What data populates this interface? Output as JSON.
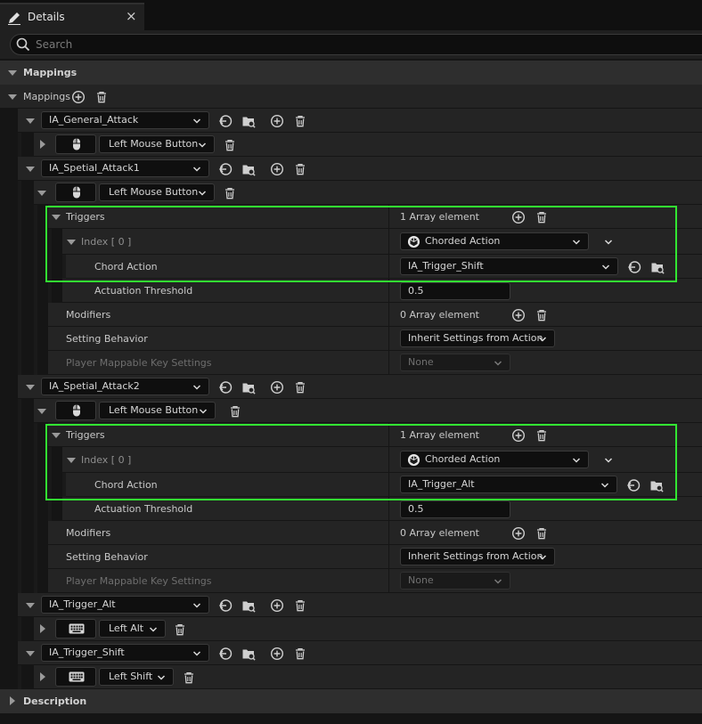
{
  "tab": {
    "title": "Details",
    "close": "×"
  },
  "search": {
    "placeholder": "Search"
  },
  "sections": {
    "mappings_category": "Mappings",
    "mappings_array": "Mappings",
    "description": "Description"
  },
  "actions": {
    "general_attack": {
      "name": "IA_General_Attack",
      "key": "Left Mouse Button"
    },
    "spetial1": {
      "name": "IA_Spetial_Attack1",
      "key": "Left Mouse Button",
      "triggers": "Triggers",
      "triggers_count": "1 Array element",
      "index": "Index [ 0 ]",
      "index_value": "Chorded Action",
      "chord_label": "Chord Action",
      "chord_value": "IA_Trigger_Shift",
      "threshold_label": "Actuation Threshold",
      "threshold_value": "0.5",
      "modifiers_label": "Modifiers",
      "modifiers_count": "0 Array element",
      "behavior_label": "Setting Behavior",
      "behavior_value": "Inherit Settings from Action",
      "pmk_label": "Player Mappable Key Settings",
      "pmk_value": "None"
    },
    "spetial2": {
      "name": "IA_Spetial_Attack2",
      "key": "Left Mouse Button",
      "triggers": "Triggers",
      "triggers_count": "1 Array element",
      "index": "Index [ 0 ]",
      "index_value": "Chorded Action",
      "chord_label": "Chord Action",
      "chord_value": "IA_Trigger_Alt",
      "threshold_label": "Actuation Threshold",
      "threshold_value": "0.5",
      "modifiers_label": "Modifiers",
      "modifiers_count": "0 Array element",
      "behavior_label": "Setting Behavior",
      "behavior_value": "Inherit Settings from Action",
      "pmk_label": "Player Mappable Key Settings",
      "pmk_value": "None"
    },
    "trigger_alt": {
      "name": "IA_Trigger_Alt",
      "key": "Left Alt"
    },
    "trigger_shift": {
      "name": "IA_Trigger_Shift",
      "key": "Left Shift"
    }
  },
  "colors": {
    "highlight": "#32e632",
    "row": "#242424",
    "bg": "#151515",
    "field": "#0f0f0f"
  }
}
